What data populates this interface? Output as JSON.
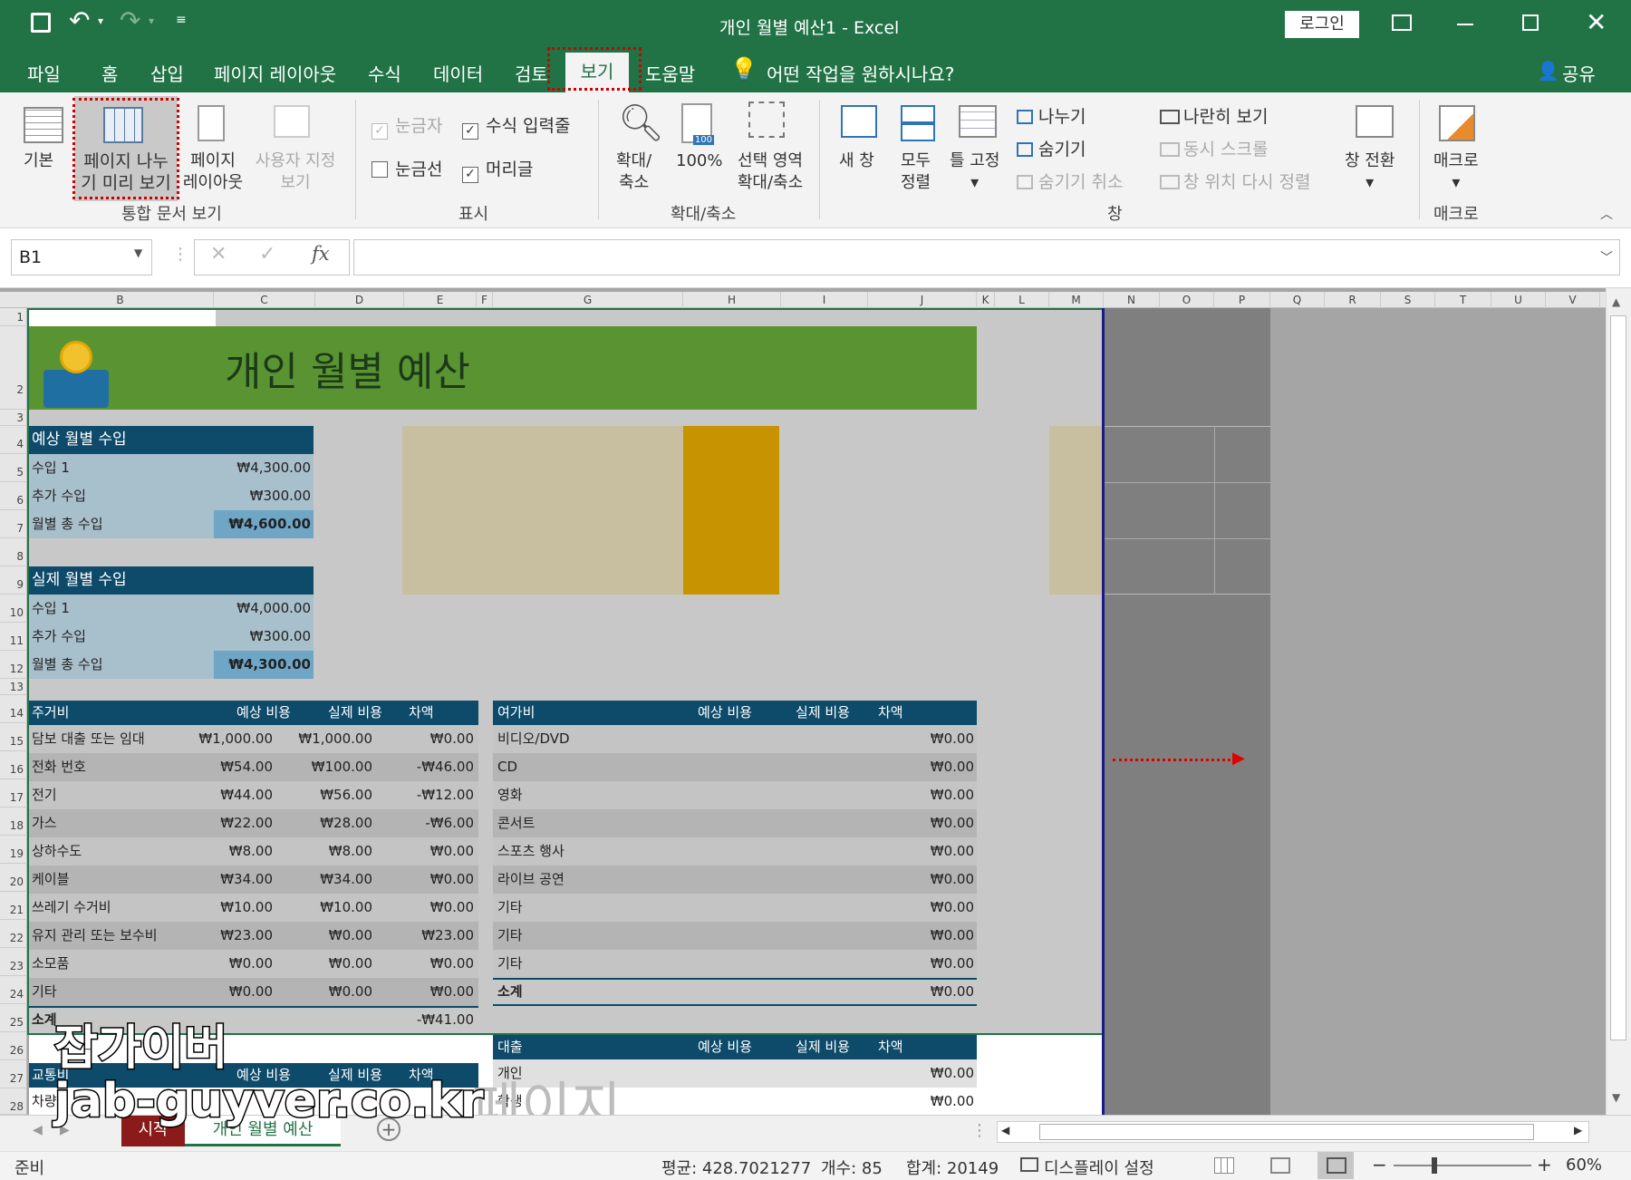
{
  "title": {
    "doc": "개인 월별 예산1",
    "app": "Excel",
    "login": "로그인"
  },
  "tabs": [
    "파일",
    "홈",
    "삽입",
    "페이지 레이아웃",
    "수식",
    "데이터",
    "검토",
    "보기",
    "도움말"
  ],
  "tell_me": "어떤 작업을 원하시나요?",
  "share": "공유",
  "ribbon": {
    "views": {
      "normal": "기본",
      "page_break_1": "페이지 나누",
      "page_break_2": "기 미리 보기",
      "page_layout_1": "페이지",
      "page_layout_2": "레이아웃",
      "custom_1": "사용자 지정",
      "custom_2": "보기",
      "group": "통합 문서 보기"
    },
    "show": {
      "ruler": "눈금자",
      "formula_bar": "수식 입력줄",
      "gridlines": "눈금선",
      "headings": "머리글",
      "group": "표시"
    },
    "zoom": {
      "zoom_1": "확대/",
      "zoom_2": "축소",
      "hundred": "100%",
      "sel_1": "선택 영역",
      "sel_2": "확대/축소",
      "group": "확대/축소"
    },
    "window": {
      "new": "새 창",
      "arrange_1": "모두",
      "arrange_2": "정렬",
      "freeze": "틀 고정",
      "split": "나누기",
      "hide": "숨기기",
      "unhide": "숨기기 취소",
      "side": "나란히 보기",
      "sync": "동시 스크롤",
      "reset": "창 위치 다시 정렬",
      "switch": "창 전환",
      "group": "창"
    },
    "macros": {
      "label": "매크로",
      "group": "매크로"
    }
  },
  "formula_bar": {
    "name_box": "B1",
    "fx": "fx",
    "value": ""
  },
  "columns": [
    "B",
    "C",
    "D",
    "E",
    "F",
    "G",
    "H",
    "I",
    "J",
    "K",
    "L",
    "M",
    "N",
    "O",
    "P",
    "Q",
    "R",
    "S",
    "T",
    "U",
    "V"
  ],
  "rows": [
    "1",
    "2",
    "3",
    "4",
    "5",
    "6",
    "7",
    "8",
    "9",
    "10",
    "11",
    "12",
    "13",
    "14",
    "15",
    "16",
    "17",
    "18",
    "19",
    "20",
    "21",
    "22",
    "23",
    "24",
    "25",
    "26",
    "27",
    "28"
  ],
  "sheet": {
    "banner": "개인 월별 예산",
    "expected_income": {
      "title": "예상 월별 수입",
      "rows": [
        [
          "수입 1",
          "₩4,300.00"
        ],
        [
          "추가 수입",
          "₩300.00"
        ],
        [
          "월별 총 수입",
          "₩4,600.00"
        ]
      ]
    },
    "actual_income": {
      "title": "실제 월별 수입",
      "rows": [
        [
          "수입 1",
          "₩4,000.00"
        ],
        [
          "추가 수입",
          "₩300.00"
        ],
        [
          "월별 총 수입",
          "₩4,300.00"
        ]
      ]
    },
    "housing": {
      "headers": [
        "주거비",
        "예상 비용",
        "실제 비용",
        "차액"
      ],
      "rows": [
        [
          "담보 대출 또는 임대",
          "₩1,000.00",
          "₩1,000.00",
          "₩0.00"
        ],
        [
          "전화 번호",
          "₩54.00",
          "₩100.00",
          "-₩46.00"
        ],
        [
          "전기",
          "₩44.00",
          "₩56.00",
          "-₩12.00"
        ],
        [
          "가스",
          "₩22.00",
          "₩28.00",
          "-₩6.00"
        ],
        [
          "상하수도",
          "₩8.00",
          "₩8.00",
          "₩0.00"
        ],
        [
          "케이블",
          "₩34.00",
          "₩34.00",
          "₩0.00"
        ],
        [
          "쓰레기 수거비",
          "₩10.00",
          "₩10.00",
          "₩0.00"
        ],
        [
          "유지 관리 또는 보수비",
          "₩23.00",
          "₩0.00",
          "₩23.00"
        ],
        [
          "소모품",
          "₩0.00",
          "₩0.00",
          "₩0.00"
        ],
        [
          "기타",
          "₩0.00",
          "₩0.00",
          "₩0.00"
        ]
      ],
      "subtotal": [
        "소계",
        "-₩41.00"
      ]
    },
    "leisure": {
      "headers": [
        "여가비",
        "예상 비용",
        "실제 비용",
        "차액"
      ],
      "rows": [
        [
          "비디오/DVD",
          "₩0.00"
        ],
        [
          "CD",
          "₩0.00"
        ],
        [
          "영화",
          "₩0.00"
        ],
        [
          "콘서트",
          "₩0.00"
        ],
        [
          "스포츠 행사",
          "₩0.00"
        ],
        [
          "라이브 공연",
          "₩0.00"
        ],
        [
          "기타",
          "₩0.00"
        ],
        [
          "기타",
          "₩0.00"
        ],
        [
          "기타",
          "₩0.00"
        ]
      ],
      "subtotal": [
        "소계",
        "₩0.00"
      ]
    },
    "loan": {
      "headers": [
        "대출",
        "예상 비용",
        "실제 비용",
        "차액"
      ],
      "rows": [
        [
          "개인",
          "₩0.00"
        ],
        [
          "학생",
          "₩0.00"
        ]
      ]
    },
    "transport": {
      "headers": [
        "교통비",
        "예상 비용",
        "실제 비용",
        "차액"
      ],
      "rows": [
        [
          "차량",
          ""
        ]
      ]
    },
    "watermark": "페이지"
  },
  "sheet_tabs": [
    "시작",
    "개인 월별 예산"
  ],
  "watermark_overlay": {
    "line1": "잡가이버",
    "line2": "jab-guyver.co.kr"
  },
  "status": {
    "ready": "준비",
    "average": "평균: 428.7021277",
    "count": "개수: 85",
    "sum": "합계: 20149",
    "display": "디스플레이 설정",
    "zoom": "60%"
  },
  "colors": {
    "excel_green": "#217346",
    "header_blue": "#0e4b6a",
    "banner_green": "#5a9432",
    "highlight_red": "#d00000"
  }
}
